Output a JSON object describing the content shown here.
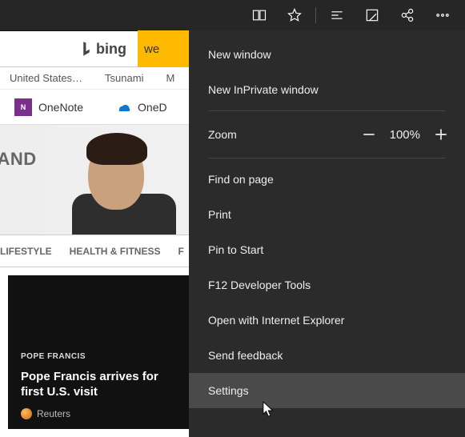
{
  "titlebar_icons": [
    "reading-view",
    "favorite",
    "hub",
    "note",
    "share",
    "more"
  ],
  "search": {
    "engine_label": "bing",
    "button_text": "we"
  },
  "trending": [
    "United States…",
    "Tsunami",
    "M"
  ],
  "apps": {
    "onenote": "OneNote",
    "onedrive": "OneD"
  },
  "hero_text": "TY AND",
  "tabs": [
    "LIFESTYLE",
    "HEALTH & FITNESS",
    "F"
  ],
  "article": {
    "badge": "POPE FRANCIS",
    "headline": "Pope Francis arrives for first U.S. visit",
    "source": "Reuters"
  },
  "menu": {
    "new_window": "New window",
    "new_inprivate": "New InPrivate window",
    "zoom_label": "Zoom",
    "zoom_value": "100%",
    "find": "Find on page",
    "print": "Print",
    "pin": "Pin to Start",
    "devtools": "F12 Developer Tools",
    "open_ie": "Open with Internet Explorer",
    "feedback": "Send feedback",
    "settings": "Settings"
  }
}
